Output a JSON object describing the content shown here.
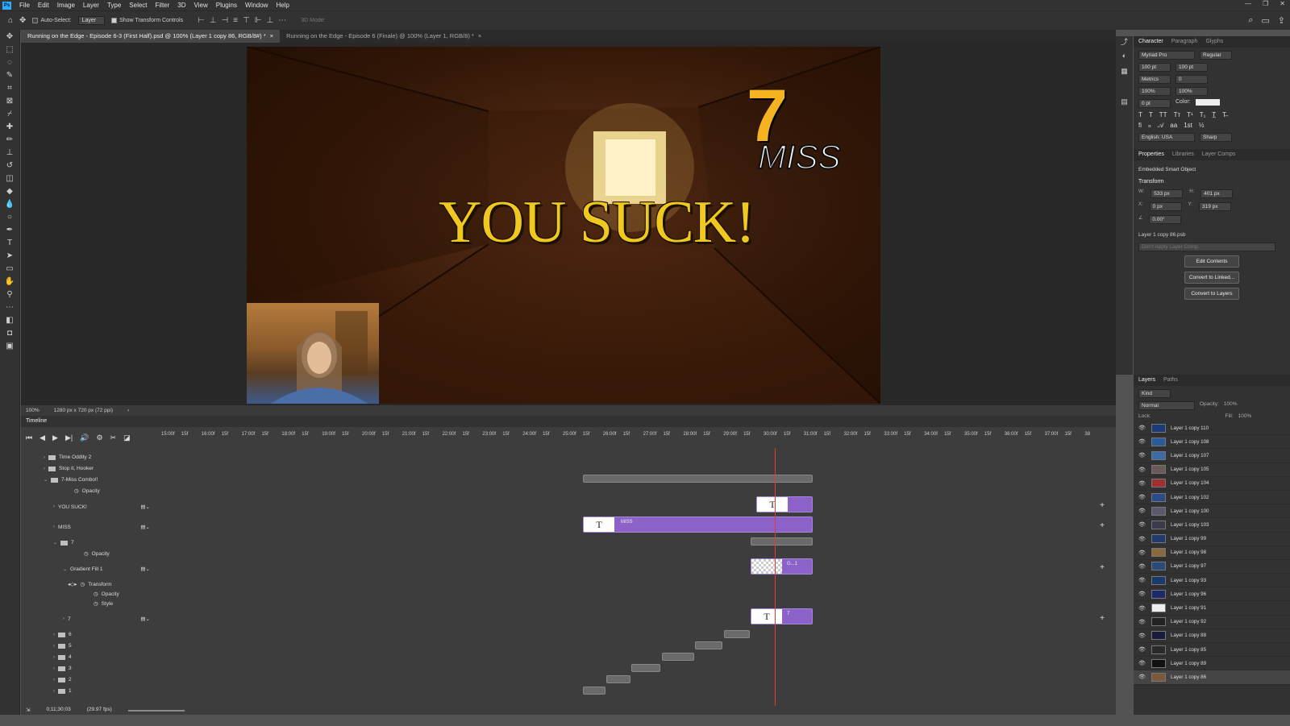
{
  "menubar": {
    "logo": "Ps",
    "items": [
      "File",
      "Edit",
      "Image",
      "Layer",
      "Type",
      "Select",
      "Filter",
      "3D",
      "View",
      "Plugins",
      "Window",
      "Help"
    ],
    "window_controls": [
      "—",
      "❐",
      "✕"
    ]
  },
  "options": {
    "auto_select_label": "Auto-Select:",
    "auto_select_value": "Layer",
    "show_transform_label": "Show Transform Controls",
    "mode_3d": "3D Mode:"
  },
  "tabs": [
    {
      "label": "Running on the Edge - Episode 6-3 (First Half).psd @ 100% (Layer 1 copy 86, RGB/8#) *",
      "close": "×"
    },
    {
      "label": "Running on the Edge - Episode 6 (Finale) @ 100% (Layer 1, RGB/8) *",
      "close": "×"
    }
  ],
  "canvas": {
    "headline": "YOU SUCK!",
    "counter_number": "7",
    "counter_word": "MISS"
  },
  "status": {
    "zoom": "100%",
    "dimensions": "1280 px x 720 px (72 ppi)",
    "arrow": "›"
  },
  "timeline": {
    "title": "Timeline",
    "timecode": "0;11;30;03",
    "fps": "(29.97 fps)",
    "ruler_labels": [
      "15:00f",
      "15f",
      "16:00f",
      "15f",
      "17:00f",
      "15f",
      "18:00f",
      "15f",
      "19:00f",
      "15f",
      "20:00f",
      "15f",
      "21:00f",
      "15f",
      "22:00f",
      "15f",
      "23:00f",
      "15f",
      "24:00f",
      "15f",
      "25:00f",
      "15f",
      "26:00f",
      "15f",
      "27:00f",
      "15f",
      "28:00f",
      "15f",
      "29:00f",
      "15f",
      "30:00f",
      "15f",
      "31:00f",
      "15f",
      "32:00f",
      "15f",
      "33:00f",
      "15f",
      "34:00f",
      "15f",
      "35:00f",
      "15f",
      "36:00f",
      "15f",
      "37:00f",
      "15f",
      "38"
    ],
    "rows": {
      "time_oddity": "Time Oddity 2",
      "stop_hooker": "Stop it, Hooker",
      "combo": "7-Miss Combo!!",
      "opacity_a": "Opacity",
      "you_suck": "YOU SUCK!",
      "miss": "MISS",
      "seven_group": "7",
      "opacity_b": "Opacity",
      "gradient": "Gradient Fill 1",
      "transform": "Transform",
      "opacity_c": "Opacity",
      "style": "Style",
      "seven_layer": "7",
      "g6": "6",
      "g5": "5",
      "g4": "4",
      "g3": "3",
      "g2": "2",
      "g1": "1"
    },
    "clips": {
      "miss_label": "MISS",
      "seven_label": "7",
      "gradient_label": "G...1",
      "text_glyph": "T"
    }
  },
  "character": {
    "tabs": [
      "Character",
      "Paragraph",
      "Glyphs"
    ],
    "font": "Myriad Pro",
    "style": "Regular",
    "size": "100 pt",
    "leading": "100 pt",
    "kerning": "Metrics",
    "tracking": "0",
    "vscale": "100%",
    "hscale": "100%",
    "baseline": "0 pt",
    "color_label": "Color:",
    "language": "English: USA",
    "aa": "Sharp"
  },
  "properties": {
    "tabs": [
      "Properties",
      "Libraries",
      "Layer Comps"
    ],
    "kind": "Embedded Smart Object",
    "section": "Transform",
    "w_label": "W:",
    "w": "533 px",
    "h_label": "H:",
    "h": "401 px",
    "x_label": "X:",
    "x": "0 px",
    "y_label": "Y:",
    "y": "319 px",
    "angle": "0.00°",
    "file": "Layer 1 copy 86.psb",
    "comp": "Don't Apply Layer Comp",
    "buttons": [
      "Edit Contents",
      "Convert to Linked...",
      "Convert to Layers"
    ]
  },
  "layers": {
    "tabs": [
      "Layers",
      "Paths"
    ],
    "filter": "Kind",
    "blend": "Normal",
    "opacity_label": "Opacity:",
    "opacity": "100%",
    "lock_label": "Lock:",
    "fill_label": "Fill:",
    "fill": "100%",
    "items": [
      "Layer 1 copy 110",
      "Layer 1 copy 108",
      "Layer 1 copy 107",
      "Layer 1 copy 105",
      "Layer 1 copy 104",
      "Layer 1 copy 102",
      "Layer 1 copy 100",
      "Layer 1 copy 103",
      "Layer 1 copy 99",
      "Layer 1 copy 98",
      "Layer 1 copy 97",
      "Layer 1 copy 93",
      "Layer 1 copy 96",
      "Layer 1 copy 91",
      "Layer 1 copy 92",
      "Layer 1 copy 88",
      "Layer 1 copy 85",
      "Layer 1 copy 89",
      "Layer 1 copy 86"
    ]
  },
  "colors": {
    "accent": "#31a8ff",
    "clip_purple": "#8c62c8",
    "playhead": "#e03a3a",
    "headline_yellow": "#f0c81e"
  }
}
